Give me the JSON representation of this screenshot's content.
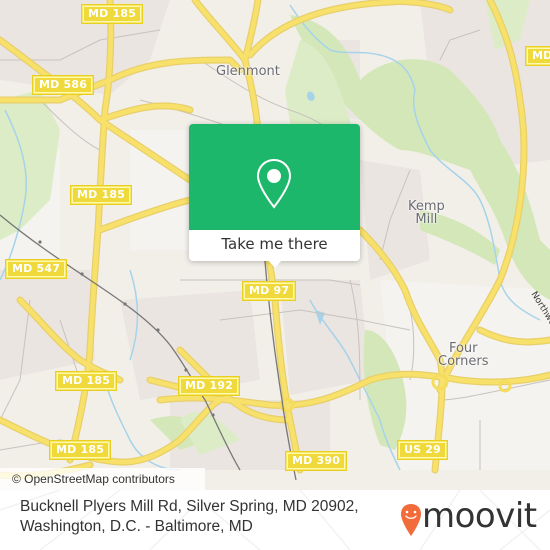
{
  "map": {
    "colors": {
      "land": "#f2efe9",
      "residential": "#ece7e3",
      "park": "#cfe5b2",
      "wood": "#d8ebc3",
      "water": "#a8d4ea",
      "road_major": "#f7dd54",
      "road_minor": "#c9c4c0",
      "rail": "#7a7a7a"
    },
    "shields": [
      {
        "label": "MD 185",
        "name": "shield-md-185-top"
      },
      {
        "label": "MD 586",
        "name": "shield-md-586"
      },
      {
        "label": "MD 185",
        "name": "shield-md-185-mid"
      },
      {
        "label": "MD 547",
        "name": "shield-md-547"
      },
      {
        "label": "MD 97",
        "name": "shield-md-97"
      },
      {
        "label": "MD 185",
        "name": "shield-md-185-lower"
      },
      {
        "label": "MD 192",
        "name": "shield-md-192"
      },
      {
        "label": "MD 185",
        "name": "shield-md-185-bottom"
      },
      {
        "label": "MD 390",
        "name": "shield-md-390"
      },
      {
        "label": "US 29",
        "name": "shield-us-29"
      },
      {
        "label": "MD",
        "name": "shield-md-right"
      }
    ],
    "places": {
      "glenmont": "Glenmont",
      "kemp_mill_1": "Kemp",
      "kemp_mill_2": "Mill",
      "four_corners_1": "Four",
      "four_corners_2": "Corners"
    },
    "river_label": "Northwest",
    "attribution": "© OpenStreetMap contributors"
  },
  "popup": {
    "icon": "map-pin-icon",
    "button_label": "Take me there",
    "accent": "#1db76b"
  },
  "footer": {
    "address_line1": "Bucknell Plyers Mill Rd, Silver Spring, MD 20902,",
    "address_line2": "Washington, D.C. - Baltimore, MD",
    "logo_text": "moovit",
    "logo_icon": "moovit-pin-icon",
    "logo_color": "#f26b3a"
  }
}
